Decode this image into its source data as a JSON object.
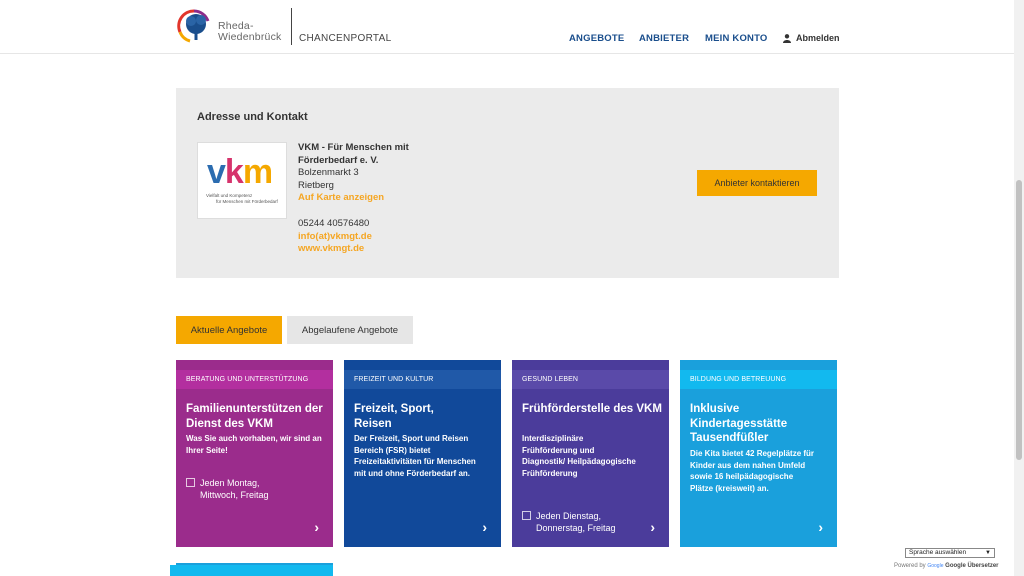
{
  "header": {
    "brand_line1": "Rheda-",
    "brand_line2": "Wiedenbrück",
    "portal": "CHANCENPORTAL",
    "nav": [
      "ANGEBOTE",
      "ANBIETER",
      "MEIN KONTO"
    ],
    "logout": "Abmelden"
  },
  "contact": {
    "heading": "Adresse und Kontakt",
    "logo_word": "vkm",
    "logo_sub1": "Vielfalt und Kompetenz",
    "logo_sub2": "für Menschen mit Förderbedarf",
    "name_line1": "VKM - Für Menschen mit",
    "name_line2": "Förderbedarf e. V.",
    "street": "Bolzenmarkt 3",
    "city": "Rietberg",
    "map_link": "Auf Karte anzeigen",
    "phone": "05244 40576480",
    "email": "info(at)vkmgt.de",
    "website": "www.vkmgt.de",
    "button": "Anbieter kontaktieren"
  },
  "tabs": {
    "active": "Aktuelle Angebote",
    "inactive": "Abgelaufene Angebote"
  },
  "cards": [
    {
      "category": "BERATUNG UND UNTERSTÜTZUNG",
      "title": "Familienunterstützen der Dienst des VKM",
      "desc": "Was Sie auch vorhaben, wir sind an Ihrer Seite!",
      "schedule": "Jeden Montag, Mittwoch, Freitag"
    },
    {
      "category": "FREIZEIT UND KULTUR",
      "title": "Freizeit, Sport, Reisen",
      "desc": "Der Freizeit, Sport und Reisen Bereich (FSR) bietet Freizeitaktivitäten für Menschen mit und ohne Förderbedarf an.",
      "schedule": ""
    },
    {
      "category": "GESUND LEBEN",
      "title": "Frühförderstelle des VKM",
      "desc": "Interdisziplinäre Frühförderung und Diagnostik/ Heilpädagogische Frühförderung",
      "schedule": "Jeden Dienstag, Donnerstag, Freitag"
    },
    {
      "category": "BILDUNG UND BETREUUNG",
      "title": "Inklusive Kindertagesstätte Tausendfüßler",
      "desc": "Die Kita bietet 42 Regelplätze für Kinder aus dem nahen Umfeld sowie 16 heilpädagogische Plätze (kreisweit) an.",
      "schedule": ""
    }
  ],
  "translate": {
    "select": "Sprache auswählen",
    "powered_by": "Powered by",
    "google": "Google",
    "service": "Google Übersetzer"
  },
  "colors": {
    "accent": "#f5a800",
    "nav_blue": "#1a4e8c",
    "card1": "#9b2c8c",
    "card2": "#11499a",
    "card3": "#4b3c9b",
    "card4": "#1aa0dc"
  }
}
